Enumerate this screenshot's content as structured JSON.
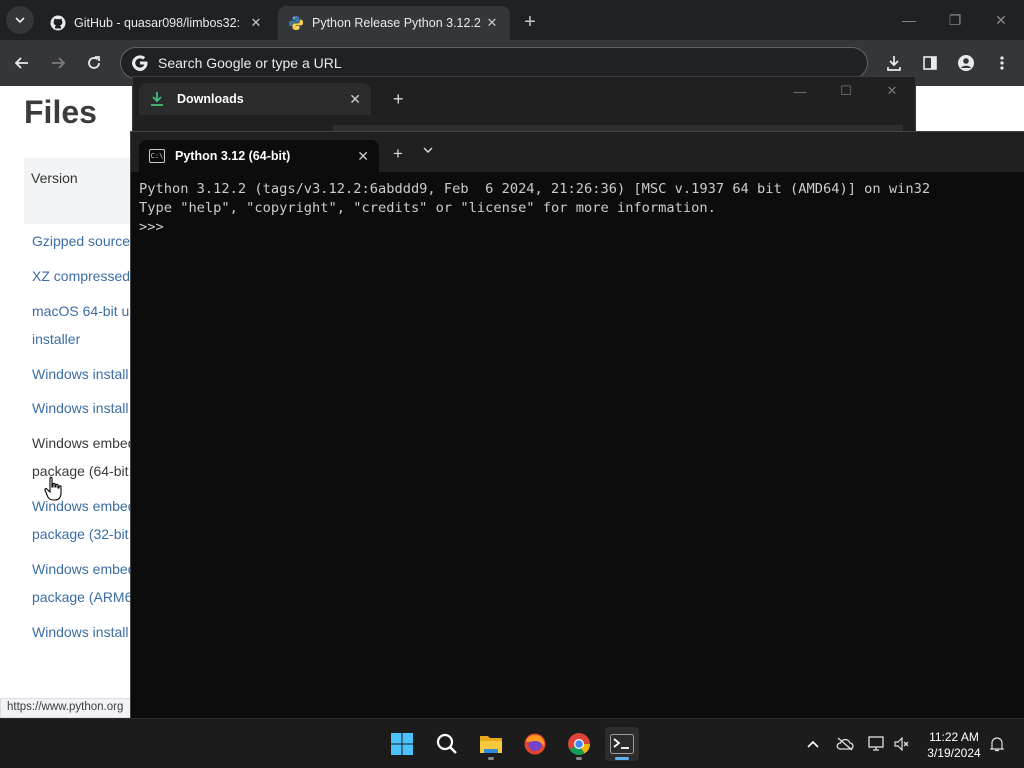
{
  "browser": {
    "tabs": [
      {
        "title": "GitHub - quasar098/limbos32:",
        "icon": "github-icon",
        "active": false
      },
      {
        "title": "Python Release Python 3.12.2 |",
        "icon": "python-icon",
        "active": true
      }
    ],
    "omnibox_placeholder": "Search Google or type a URL",
    "status_url": "https://www.python.org"
  },
  "page": {
    "heading": "Files",
    "column_header": "Version",
    "file_links": [
      "Gzipped source",
      "XZ compressed",
      "macOS 64-bit u",
      "installer",
      "Windows install",
      "Windows install",
      "Windows embed",
      "package (64-bit",
      "Windows embed",
      "package (32-bit",
      "Windows embed",
      "package (ARM6",
      "Windows install"
    ]
  },
  "downloads_window": {
    "tab_title": "Downloads"
  },
  "terminal": {
    "tab_title": "Python 3.12 (64-bit)",
    "lines": [
      "Python 3.12.2 (tags/v3.12.2:6abddd9, Feb  6 2024, 21:26:36) [MSC v.1937 64 bit (AMD64)] on win32",
      "Type \"help\", \"copyright\", \"credits\" or \"license\" for more information.",
      ">>> "
    ]
  },
  "taskbar": {
    "apps": [
      "start-icon",
      "search-icon",
      "file-explorer-icon",
      "firefox-icon",
      "chrome-icon",
      "terminal-icon"
    ],
    "time": "11:22 AM",
    "date": "3/19/2024"
  },
  "colors": {
    "link": "#3b6ea5",
    "terminal_bg": "#0c0c0c",
    "chrome_bg": "#202124"
  }
}
